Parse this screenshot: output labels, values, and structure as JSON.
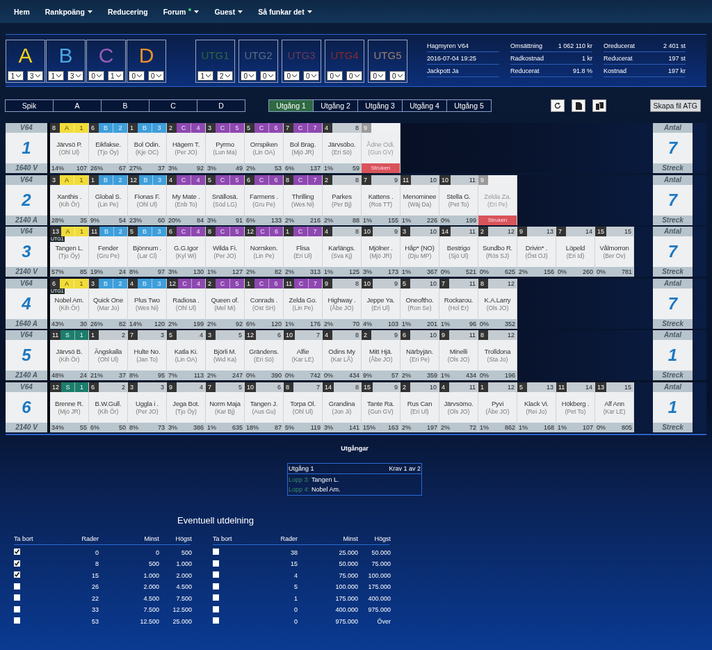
{
  "nav": [
    {
      "label": "Hem",
      "menu": false,
      "new": false
    },
    {
      "label": "Rankpoäng",
      "menu": true,
      "new": false
    },
    {
      "label": "Reducering",
      "menu": false,
      "new": false
    },
    {
      "label": "Forum",
      "menu": true,
      "new": true
    },
    {
      "label": "Guest",
      "menu": true,
      "new": false
    },
    {
      "label": "Så funkar det",
      "menu": true,
      "new": false
    }
  ],
  "groups": [
    {
      "label": "A",
      "color": "#f2d21a",
      "selects": [
        "1",
        "3"
      ]
    },
    {
      "label": "B",
      "color": "#4aa6e0",
      "selects": [
        "1",
        "3"
      ]
    },
    {
      "label": "C",
      "color": "#9a5cb8",
      "selects": [
        "0",
        "1"
      ]
    },
    {
      "label": "D",
      "color": "#e8902a",
      "selects": [
        "0",
        "0"
      ]
    }
  ],
  "utg_boxes": [
    {
      "label": "UTG1",
      "color": "#2f6a3a",
      "selects": [
        "1",
        "2"
      ]
    },
    {
      "label": "UTG2",
      "color": "#5a6e86",
      "selects": [
        "0",
        "0"
      ]
    },
    {
      "label": "UTG3",
      "color": "#6a3a5a",
      "selects": [
        "0",
        "0"
      ]
    },
    {
      "label": "UTG4",
      "color": "#8a2a2a",
      "selects": [
        "0",
        "0"
      ]
    },
    {
      "label": "UTG5",
      "color": "#9a8070",
      "selects": [
        "0",
        "0"
      ]
    }
  ],
  "info": [
    [
      {
        "label": "Hagmyren V64"
      },
      {
        "label": "2016-07-04 19:25"
      },
      {
        "label": "Jackpott Ja"
      }
    ],
    [
      {
        "label": "Omsättning",
        "value": "1 062 110 kr"
      },
      {
        "label": "Radkostnad",
        "value": "1 kr"
      },
      {
        "label": "Reducerat",
        "value": "91.8 %"
      }
    ],
    [
      {
        "label": "Oreducerat",
        "value": "2 401 st"
      },
      {
        "label": "Reducerat",
        "value": "197 st"
      },
      {
        "label": "Kostnad",
        "value": "197 kr"
      }
    ]
  ],
  "filters": [
    {
      "label": "Spik",
      "selected": false
    },
    {
      "label": "A",
      "selected": false
    },
    {
      "label": "B",
      "selected": false
    },
    {
      "label": "C",
      "selected": false
    },
    {
      "label": "D",
      "selected": false
    }
  ],
  "utg_tabs": [
    {
      "label": "Utgång 1",
      "selected": true
    },
    {
      "label": "Utgång 2",
      "selected": false
    },
    {
      "label": "Utgång 3",
      "selected": false
    },
    {
      "label": "Utgång 4",
      "selected": false
    },
    {
      "label": "Utgång 5",
      "selected": false
    }
  ],
  "create_button": "Skapa fil ATG",
  "races": [
    {
      "game": "V64",
      "number": "1",
      "distance": "1640 V",
      "count_label": "Antal",
      "count": "7",
      "footer_label": "Streck",
      "horses": [
        {
          "num": "8",
          "group": "A",
          "rank": "1",
          "name": "Järvsö P.",
          "driver": "(Ohl Ul)",
          "pct": "14%",
          "points": "107",
          "scratched": false
        },
        {
          "num": "6",
          "group": "B",
          "rank": "2",
          "name": "Eikfakse.",
          "driver": "(Tjo Öy)",
          "pct": "26%",
          "points": "67",
          "scratched": false
        },
        {
          "num": "1",
          "group": "B",
          "rank": "3",
          "name": "Bol Odin.",
          "driver": "(Kje OC)",
          "pct": "27%",
          "points": "37",
          "scratched": false
        },
        {
          "num": "2",
          "group": "C",
          "rank": "4",
          "name": "Hägern T.",
          "driver": "(Per JO)",
          "pct": "3%",
          "points": "92",
          "scratched": false
        },
        {
          "num": "3",
          "group": "C",
          "rank": "5",
          "name": "Pyrmo",
          "driver": "(Lun Ma)",
          "pct": "3%",
          "points": "49",
          "scratched": false
        },
        {
          "num": "5",
          "group": "C",
          "rank": "6",
          "name": "Orrspiken",
          "driver": "(Lin OA)",
          "pct": "2%",
          "points": "53",
          "scratched": false
        },
        {
          "num": "7",
          "group": "C",
          "rank": "7",
          "name": "Bol Brag.",
          "driver": "(Mjö JR)",
          "pct": "6%",
          "points": "137",
          "scratched": false
        },
        {
          "num": "4",
          "rank": "8",
          "name": "Järvsöbo.",
          "driver": "(Eri Sö)",
          "pct": "1%",
          "points": "59",
          "scratched": false
        },
        {
          "num": "9",
          "name": "Ådne Odi.",
          "driver": "(Gun GV)",
          "status": "Struken",
          "scratched": true
        }
      ]
    },
    {
      "game": "V64",
      "number": "2",
      "distance": "2140 A",
      "count_label": "Antal",
      "count": "7",
      "footer_label": "Streck",
      "horses": [
        {
          "num": "3",
          "group": "A",
          "rank": "1",
          "name": "Xanthis .",
          "driver": "(Kih Ör)",
          "pct": "28%",
          "points": "35",
          "scratched": false
        },
        {
          "num": "1",
          "group": "B",
          "rank": "2",
          "name": "Global S.",
          "driver": "(Lin Pe)",
          "pct": "9%",
          "points": "54",
          "scratched": false
        },
        {
          "num": "12",
          "group": "B",
          "rank": "3",
          "name": "Fionas F.",
          "driver": "(Ohl Ul)",
          "pct": "23%",
          "points": "60",
          "scratched": false
        },
        {
          "num": "4",
          "group": "C",
          "rank": "4",
          "name": "My Mate .",
          "driver": "(Enb To)",
          "pct": "20%",
          "points": "84",
          "scratched": false
        },
        {
          "num": "5",
          "group": "C",
          "rank": "5",
          "name": "Snällosä.",
          "driver": "(Söd LG)",
          "pct": "3%",
          "points": "91",
          "scratched": false
        },
        {
          "num": "6",
          "group": "C",
          "rank": "6",
          "name": "Farmens .",
          "driver": "(Gru Pe)",
          "pct": "6%",
          "points": "133",
          "scratched": false
        },
        {
          "num": "8",
          "group": "C",
          "rank": "7",
          "name": "Thrilling",
          "driver": "(Wes Ni)",
          "pct": "2%",
          "points": "216",
          "scratched": false
        },
        {
          "num": "2",
          "rank": "8",
          "name": "Parkes",
          "driver": "(Per Bj)",
          "pct": "2%",
          "points": "88",
          "scratched": false
        },
        {
          "num": "7",
          "rank": "9",
          "name": "Kattens .",
          "driver": "(Ros TT)",
          "pct": "1%",
          "points": "155",
          "scratched": false
        },
        {
          "num": "11",
          "rank": "10",
          "name": "Menominee",
          "driver": "(Wäj Da)",
          "pct": "1%",
          "points": "226",
          "scratched": false
        },
        {
          "num": "10",
          "rank": "11",
          "name": "Stella G.",
          "driver": "(Pet To)",
          "pct": "0%",
          "points": "199",
          "scratched": false
        },
        {
          "num": "9",
          "name": "Zelda Za.",
          "driver": "(Eri Pe)",
          "status": "Struken",
          "scratched": true
        }
      ]
    },
    {
      "game": "V64",
      "number": "3",
      "distance": "2140 V",
      "count_label": "Antal",
      "count": "7",
      "footer_label": "Streck",
      "horses": [
        {
          "num": "13",
          "group": "A",
          "rank": "1",
          "name": "Tangen L.",
          "driver": "(Tjo Öy)",
          "pct": "57%",
          "points": "85",
          "scratched": false,
          "tag": "UTG1"
        },
        {
          "num": "11",
          "group": "B",
          "rank": "2",
          "name": "Fender",
          "driver": "(Gru Pe)",
          "pct": "19%",
          "points": "24",
          "scratched": false
        },
        {
          "num": "5",
          "group": "B",
          "rank": "3",
          "name": "Bjönnum .",
          "driver": "(Lar Cl)",
          "pct": "8%",
          "points": "97",
          "scratched": false
        },
        {
          "num": "6",
          "group": "C",
          "rank": "4",
          "name": "G.G.Igor",
          "driver": "(Kyl Wi)",
          "pct": "3%",
          "points": "130",
          "scratched": false
        },
        {
          "num": "8",
          "group": "C",
          "rank": "5",
          "name": "Wilda Fi.",
          "driver": "(Per JO)",
          "pct": "1%",
          "points": "127",
          "scratched": false
        },
        {
          "num": "12",
          "group": "C",
          "rank": "6",
          "name": "Norrsken.",
          "driver": "(Lin Pe)",
          "pct": "2%",
          "points": "82",
          "scratched": false
        },
        {
          "num": "1",
          "group": "C",
          "rank": "7",
          "name": "Flisa",
          "driver": "(Eri Ul)",
          "pct": "2%",
          "points": "313",
          "scratched": false
        },
        {
          "num": "4",
          "rank": "8",
          "name": "Karlängs.",
          "driver": "(Sva Kj)",
          "pct": "1%",
          "points": "125",
          "scratched": false
        },
        {
          "num": "10",
          "rank": "9",
          "name": "Mjölner .",
          "driver": "(Mjö JR)",
          "pct": "3%",
          "points": "173",
          "scratched": false
        },
        {
          "num": "3",
          "rank": "10",
          "name": "Håp* (NO)",
          "driver": "(Dju MP)",
          "pct": "1%",
          "points": "367",
          "scratched": false
        },
        {
          "num": "14",
          "rank": "11",
          "name": "Bestrigo",
          "driver": "(Sjö Ul)",
          "pct": "0%",
          "points": "521",
          "scratched": false
        },
        {
          "num": "2",
          "rank": "12",
          "name": "Sundbo R.",
          "driver": "(Rös SJ)",
          "pct": "0%",
          "points": "625",
          "scratched": false
        },
        {
          "num": "9",
          "rank": "13",
          "name": "Drivin* .",
          "driver": "(Öst OJ)",
          "pct": "2%",
          "points": "156",
          "scratched": false
        },
        {
          "num": "7",
          "rank": "14",
          "name": "Löpeld",
          "driver": "(Eri Id)",
          "pct": "0%",
          "points": "260",
          "scratched": false
        },
        {
          "num": "15",
          "rank": "15",
          "name": "Vålmorron",
          "driver": "(Ber Ov)",
          "pct": "0%",
          "points": "781",
          "scratched": false
        }
      ]
    },
    {
      "game": "V64",
      "number": "4",
      "distance": "1640 A",
      "count_label": "Antal",
      "count": "7",
      "footer_label": "Streck",
      "horses": [
        {
          "num": "6",
          "group": "A",
          "rank": "1",
          "name": "Nobel Am.",
          "driver": "(Kih Ör)",
          "pct": "43%",
          "points": "30",
          "scratched": false,
          "tag": "UTG1"
        },
        {
          "num": "3",
          "group": "B",
          "rank": "2",
          "name": "Quick One",
          "driver": "(Mar Jo)",
          "pct": "26%",
          "points": "82",
          "scratched": false
        },
        {
          "num": "4",
          "group": "B",
          "rank": "3",
          "name": "Plus Two",
          "driver": "(Wes Ni)",
          "pct": "14%",
          "points": "120",
          "scratched": false
        },
        {
          "num": "12",
          "group": "C",
          "rank": "4",
          "name": "Radiosa .",
          "driver": "(Ohl Ul)",
          "pct": "2%",
          "points": "199",
          "scratched": false
        },
        {
          "num": "2",
          "group": "C",
          "rank": "5",
          "name": "Queen of.",
          "driver": "(Mel Mi)",
          "pct": "2%",
          "points": "92",
          "scratched": false
        },
        {
          "num": "1",
          "group": "C",
          "rank": "6",
          "name": "Conrads .",
          "driver": "(Ost SH)",
          "pct": "6%",
          "points": "120",
          "scratched": false
        },
        {
          "num": "11",
          "group": "C",
          "rank": "7",
          "name": "Zelda Go.",
          "driver": "(Lin Pe)",
          "pct": "1%",
          "points": "176",
          "scratched": false
        },
        {
          "num": "9",
          "rank": "8",
          "name": "Highway .",
          "driver": "(Åbe JO)",
          "pct": "2%",
          "points": "70",
          "scratched": false
        },
        {
          "num": "10",
          "rank": "9",
          "name": "Jeppe Ya.",
          "driver": "(Eri Ul)",
          "pct": "4%",
          "points": "103",
          "scratched": false
        },
        {
          "num": "5",
          "rank": "10",
          "name": "Oneoftho.",
          "driver": "(Ron Se)",
          "pct": "1%",
          "points": "201",
          "scratched": false
        },
        {
          "num": "7",
          "rank": "11",
          "name": "Rockarou.",
          "driver": "(Hol Er)",
          "pct": "1%",
          "points": "96",
          "scratched": false
        },
        {
          "num": "8",
          "rank": "12",
          "name": "K.A.Larry",
          "driver": "(Ols JO)",
          "pct": "0%",
          "points": "352",
          "scratched": false
        }
      ]
    },
    {
      "game": "V64",
      "number": "5",
      "distance": "2140 A",
      "count_label": "Antal",
      "count": "1",
      "footer_label": "Streck",
      "horses": [
        {
          "num": "11",
          "group": "S",
          "rank": "1",
          "name": "Järvsö B.",
          "driver": "(Kih Ör)",
          "pct": "48%",
          "points": "24",
          "scratched": false
        },
        {
          "num": "1",
          "rank": "2",
          "name": "Ängskalla",
          "driver": "(Ohl Ul)",
          "pct": "21%",
          "points": "37",
          "scratched": false
        },
        {
          "num": "7",
          "rank": "3",
          "name": "Hulte No.",
          "driver": "(Jan To)",
          "pct": "8%",
          "points": "95",
          "scratched": false
        },
        {
          "num": "5",
          "rank": "4",
          "name": "Katla Ki.",
          "driver": "(Lin OA)",
          "pct": "7%",
          "points": "113",
          "scratched": false
        },
        {
          "num": "3",
          "rank": "5",
          "name": "Björli M.",
          "driver": "(Wid Ka)",
          "pct": "2%",
          "points": "247",
          "scratched": false
        },
        {
          "num": "12",
          "rank": "6",
          "name": "Grändens.",
          "driver": "(Eri Sö)",
          "pct": "0%",
          "points": "390",
          "scratched": false
        },
        {
          "num": "10",
          "rank": "7",
          "name": "Alfie",
          "driver": "(Kar LE)",
          "pct": "0%",
          "points": "742",
          "scratched": false
        },
        {
          "num": "4",
          "rank": "8",
          "name": "Odins My",
          "driver": "(Kar LÅ)",
          "pct": "0%",
          "points": "434",
          "scratched": false
        },
        {
          "num": "2",
          "rank": "9",
          "name": "Mitt Hjä.",
          "driver": "(Åbe JO)",
          "pct": "9%",
          "points": "57",
          "scratched": false
        },
        {
          "num": "6",
          "rank": "10",
          "name": "Närbyjän.",
          "driver": "(Eri Pe)",
          "pct": "2%",
          "points": "359",
          "scratched": false
        },
        {
          "num": "9",
          "rank": "11",
          "name": "Minelli",
          "driver": "(Ols JO)",
          "pct": "1%",
          "points": "434",
          "scratched": false
        },
        {
          "num": "8",
          "rank": "12",
          "name": "Trolldona",
          "driver": "(Sta Jo)",
          "pct": "0%",
          "points": "196",
          "scratched": false
        }
      ]
    },
    {
      "game": "V64",
      "number": "6",
      "distance": "2140 V",
      "count_label": "Antal",
      "count": "1",
      "footer_label": "Streck",
      "horses": [
        {
          "num": "12",
          "group": "S",
          "rank": "1",
          "name": "Brenne R.",
          "driver": "(Mjö JR)",
          "pct": "34%",
          "points": "55",
          "scratched": false
        },
        {
          "num": "6",
          "rank": "2",
          "name": "B.W.Gull.",
          "driver": "(Kih Ör)",
          "pct": "6%",
          "points": "50",
          "scratched": false
        },
        {
          "num": "3",
          "rank": "3",
          "name": "Uggla i .",
          "driver": "(Per JO)",
          "pct": "8%",
          "points": "73",
          "scratched": false
        },
        {
          "num": "9",
          "rank": "4",
          "name": "Jega Bot.",
          "driver": "(Tjo Öy)",
          "pct": "3%",
          "points": "386",
          "scratched": false
        },
        {
          "num": "7",
          "rank": "5",
          "name": "Norm Maja",
          "driver": "(Kar Bj)",
          "pct": "1%",
          "points": "635",
          "scratched": false
        },
        {
          "num": "10",
          "rank": "6",
          "name": "Tangen J.",
          "driver": "(Aus Gu)",
          "pct": "18%",
          "points": "87",
          "scratched": false
        },
        {
          "num": "8",
          "rank": "7",
          "name": "Torpa Ol.",
          "driver": "(Ohl Ul)",
          "pct": "5%",
          "points": "119",
          "scratched": false
        },
        {
          "num": "14",
          "rank": "8",
          "name": "Grandina",
          "driver": "(Jon Ji)",
          "pct": "3%",
          "points": "141",
          "scratched": false
        },
        {
          "num": "15",
          "rank": "9",
          "name": "Tante Ra.",
          "driver": "(Gun GV)",
          "pct": "15%",
          "points": "163",
          "scratched": false
        },
        {
          "num": "2",
          "rank": "10",
          "name": "Rus Can",
          "driver": "(Eri Ul)",
          "pct": "2%",
          "points": "197",
          "scratched": false
        },
        {
          "num": "4",
          "rank": "11",
          "name": "Järvsömo.",
          "driver": "(Ols JO)",
          "pct": "2%",
          "points": "72",
          "scratched": false
        },
        {
          "num": "1",
          "rank": "12",
          "name": "Pyvi",
          "driver": "(Åbe JO)",
          "pct": "1%",
          "points": "862",
          "scratched": false
        },
        {
          "num": "5",
          "rank": "13",
          "name": "Klack Vi.",
          "driver": "(Rei Jo)",
          "pct": "1%",
          "points": "168",
          "scratched": false
        },
        {
          "num": "11",
          "rank": "14",
          "name": "Hökberg .",
          "driver": "(Pet To)",
          "pct": "1%",
          "points": "107",
          "scratched": false
        },
        {
          "num": "13",
          "rank": "15",
          "name": "Alf Ann",
          "driver": "(Kar LE)",
          "pct": "0%",
          "points": "805",
          "scratched": false
        }
      ]
    }
  ],
  "outcomes": {
    "title": "Utgångar",
    "box": {
      "name": "Utgång 1",
      "requirement": "Krav 1 av 2",
      "entries": [
        {
          "race": "Lopp 3:",
          "horse": "Tangen L."
        },
        {
          "race": "Lopp 4:",
          "horse": "Nobel Am."
        }
      ]
    }
  },
  "payout": {
    "title": "Eventuell utdelning",
    "halves": [
      {
        "columns": [
          "Ta bort",
          "Rader",
          "Minst",
          "Högst"
        ],
        "rows": [
          {
            "checked": true,
            "rows": "0",
            "min": "0",
            "max": "500"
          },
          {
            "checked": true,
            "rows": "8",
            "min": "500",
            "max": "1.000"
          },
          {
            "checked": true,
            "rows": "15",
            "min": "1.000",
            "max": "2.000"
          },
          {
            "checked": false,
            "rows": "26",
            "min": "2.000",
            "max": "4.500"
          },
          {
            "checked": false,
            "rows": "22",
            "min": "4.500",
            "max": "7.500"
          },
          {
            "checked": false,
            "rows": "33",
            "min": "7.500",
            "max": "12.500"
          },
          {
            "checked": false,
            "rows": "53",
            "min": "12.500",
            "max": "25.000"
          }
        ]
      },
      {
        "columns": [
          "Ta bort",
          "Rader",
          "Minst",
          "Högst"
        ],
        "rows": [
          {
            "checked": false,
            "rows": "38",
            "min": "25.000",
            "max": "50.000"
          },
          {
            "checked": false,
            "rows": "15",
            "min": "50.000",
            "max": "75.000"
          },
          {
            "checked": false,
            "rows": "4",
            "min": "75.000",
            "max": "100.000"
          },
          {
            "checked": false,
            "rows": "5",
            "min": "100.000",
            "max": "175.000"
          },
          {
            "checked": false,
            "rows": "1",
            "min": "175.000",
            "max": "400.000"
          },
          {
            "checked": false,
            "rows": "0",
            "min": "400.000",
            "max": "975.000"
          },
          {
            "checked": false,
            "rows": "0",
            "min": "975.000",
            "max": "Över"
          }
        ]
      }
    ]
  }
}
